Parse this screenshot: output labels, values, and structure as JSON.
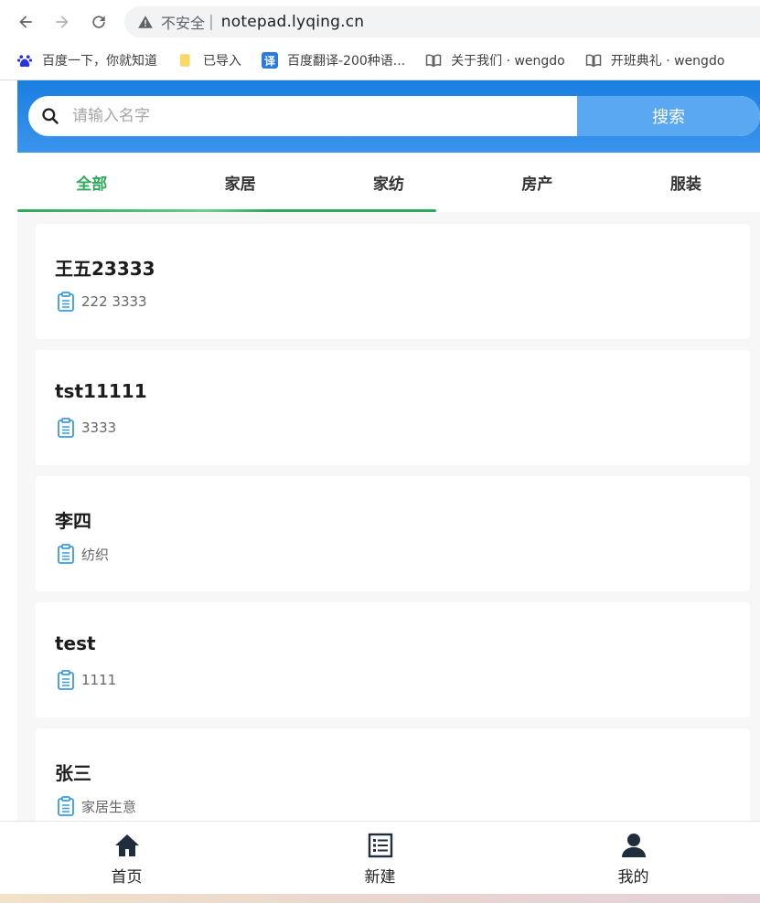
{
  "browser": {
    "insecure_label": "不安全",
    "separator": "|",
    "url": "notepad.lyqing.cn",
    "bookmarks": [
      {
        "label": "百度一下，你就知道",
        "icon": "baidu-paw-icon"
      },
      {
        "label": "已导入",
        "icon": "folder-icon"
      },
      {
        "label": "百度翻译-200种语...",
        "icon": "translate-icon",
        "icon_text": "译"
      },
      {
        "label": "关于我们 · wengdo",
        "icon": "book-icon"
      },
      {
        "label": "开班典礼 · wengdo",
        "icon": "book-icon"
      }
    ]
  },
  "search": {
    "placeholder": "请输入名字",
    "value": "",
    "button_label": "搜索"
  },
  "tabs": [
    {
      "label": "全部",
      "active": true
    },
    {
      "label": "家居",
      "active": false
    },
    {
      "label": "家纺",
      "active": false
    },
    {
      "label": "房产",
      "active": false
    },
    {
      "label": "服装",
      "active": false
    }
  ],
  "contacts": [
    {
      "name": "王五23333",
      "note": "222 3333"
    },
    {
      "name": "tst11111",
      "note": "3333"
    },
    {
      "name": "李四",
      "note": "纺织"
    },
    {
      "name": "test",
      "note": "1111"
    },
    {
      "name": "张三",
      "note": "家居生意"
    }
  ],
  "bottom_nav": [
    {
      "label": "首页",
      "icon": "home-icon"
    },
    {
      "label": "新建",
      "icon": "list-icon"
    },
    {
      "label": "我的",
      "icon": "user-icon"
    }
  ],
  "colors": {
    "header_blue": "#1a7fe0",
    "search_button": "#5aa8f2",
    "active_tab": "#2fa85a",
    "phone_green": "#22d03a",
    "edit_blue": "#3a9be0",
    "delete_red": "#e0453a",
    "clip_blue": "#3a9be0"
  }
}
